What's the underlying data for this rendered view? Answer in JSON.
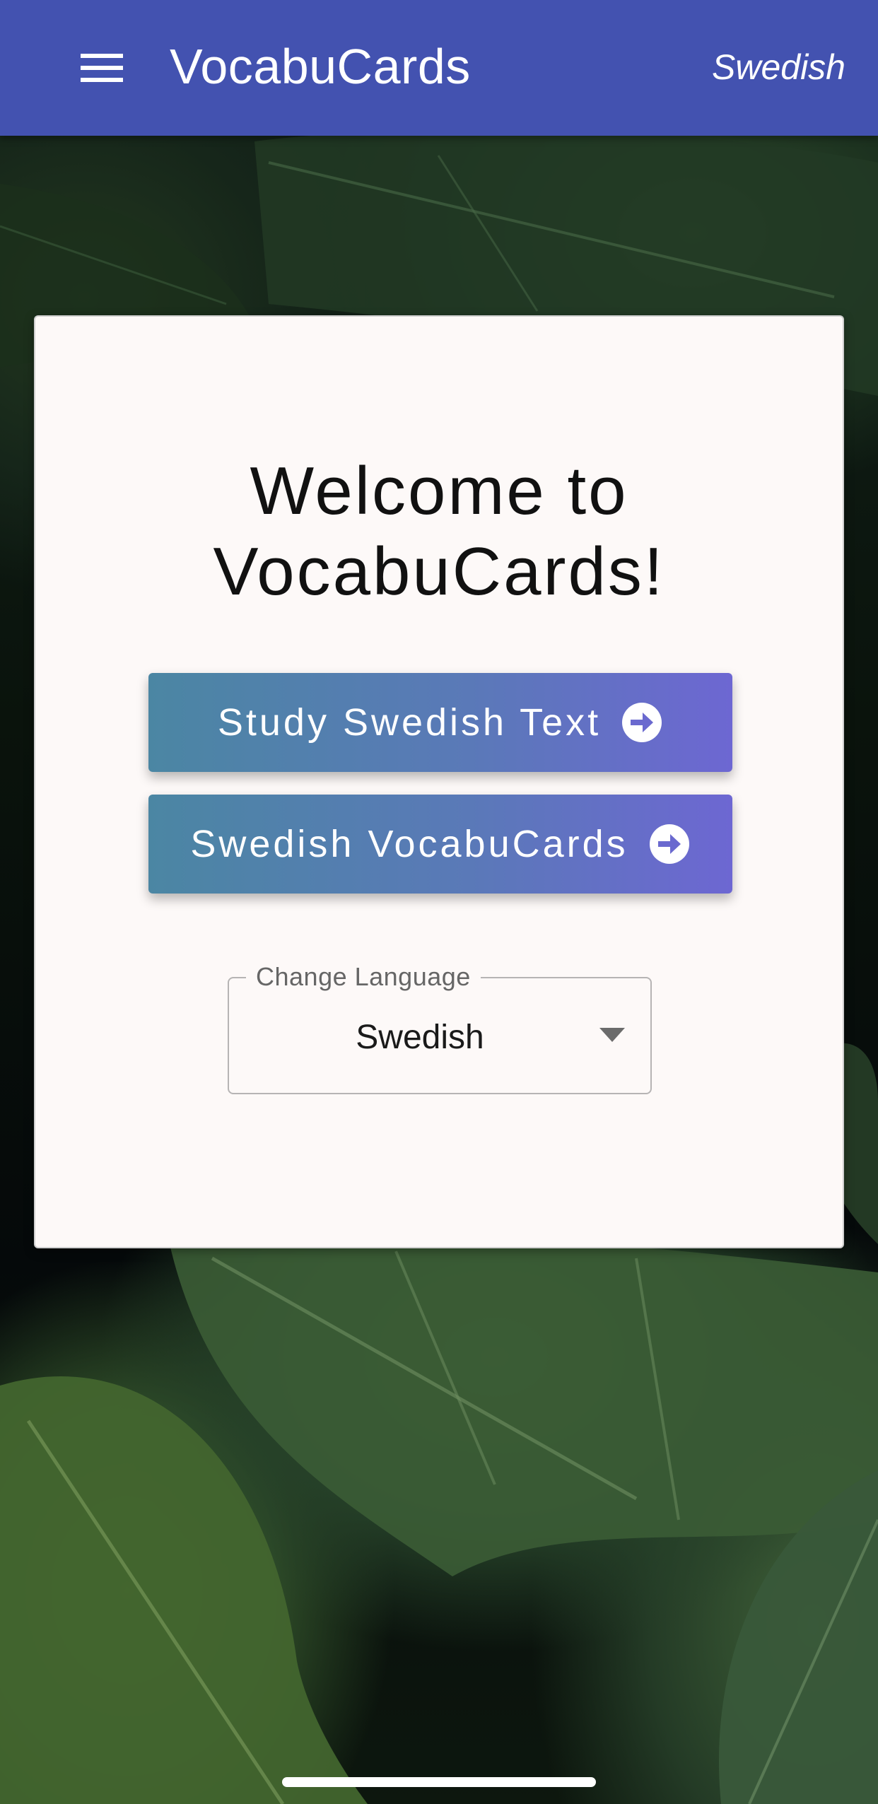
{
  "appbar": {
    "title": "VocabuCards",
    "language": "Swedish",
    "menu_icon": "hamburger-menu-icon",
    "background": "#4352b0"
  },
  "card": {
    "welcome_line1": "Welcome to",
    "welcome_line2": "VocabuCards!",
    "buttons": [
      {
        "label": "Study Swedish Text",
        "icon": "arrow-circle-right-icon"
      },
      {
        "label": "Swedish VocabuCards",
        "icon": "arrow-circle-right-icon"
      }
    ],
    "button_gradient": [
      "#4b86a3",
      "#6d67d2"
    ]
  },
  "language_select": {
    "label": "Change Language",
    "value": "Swedish",
    "icon": "caret-down-icon"
  }
}
